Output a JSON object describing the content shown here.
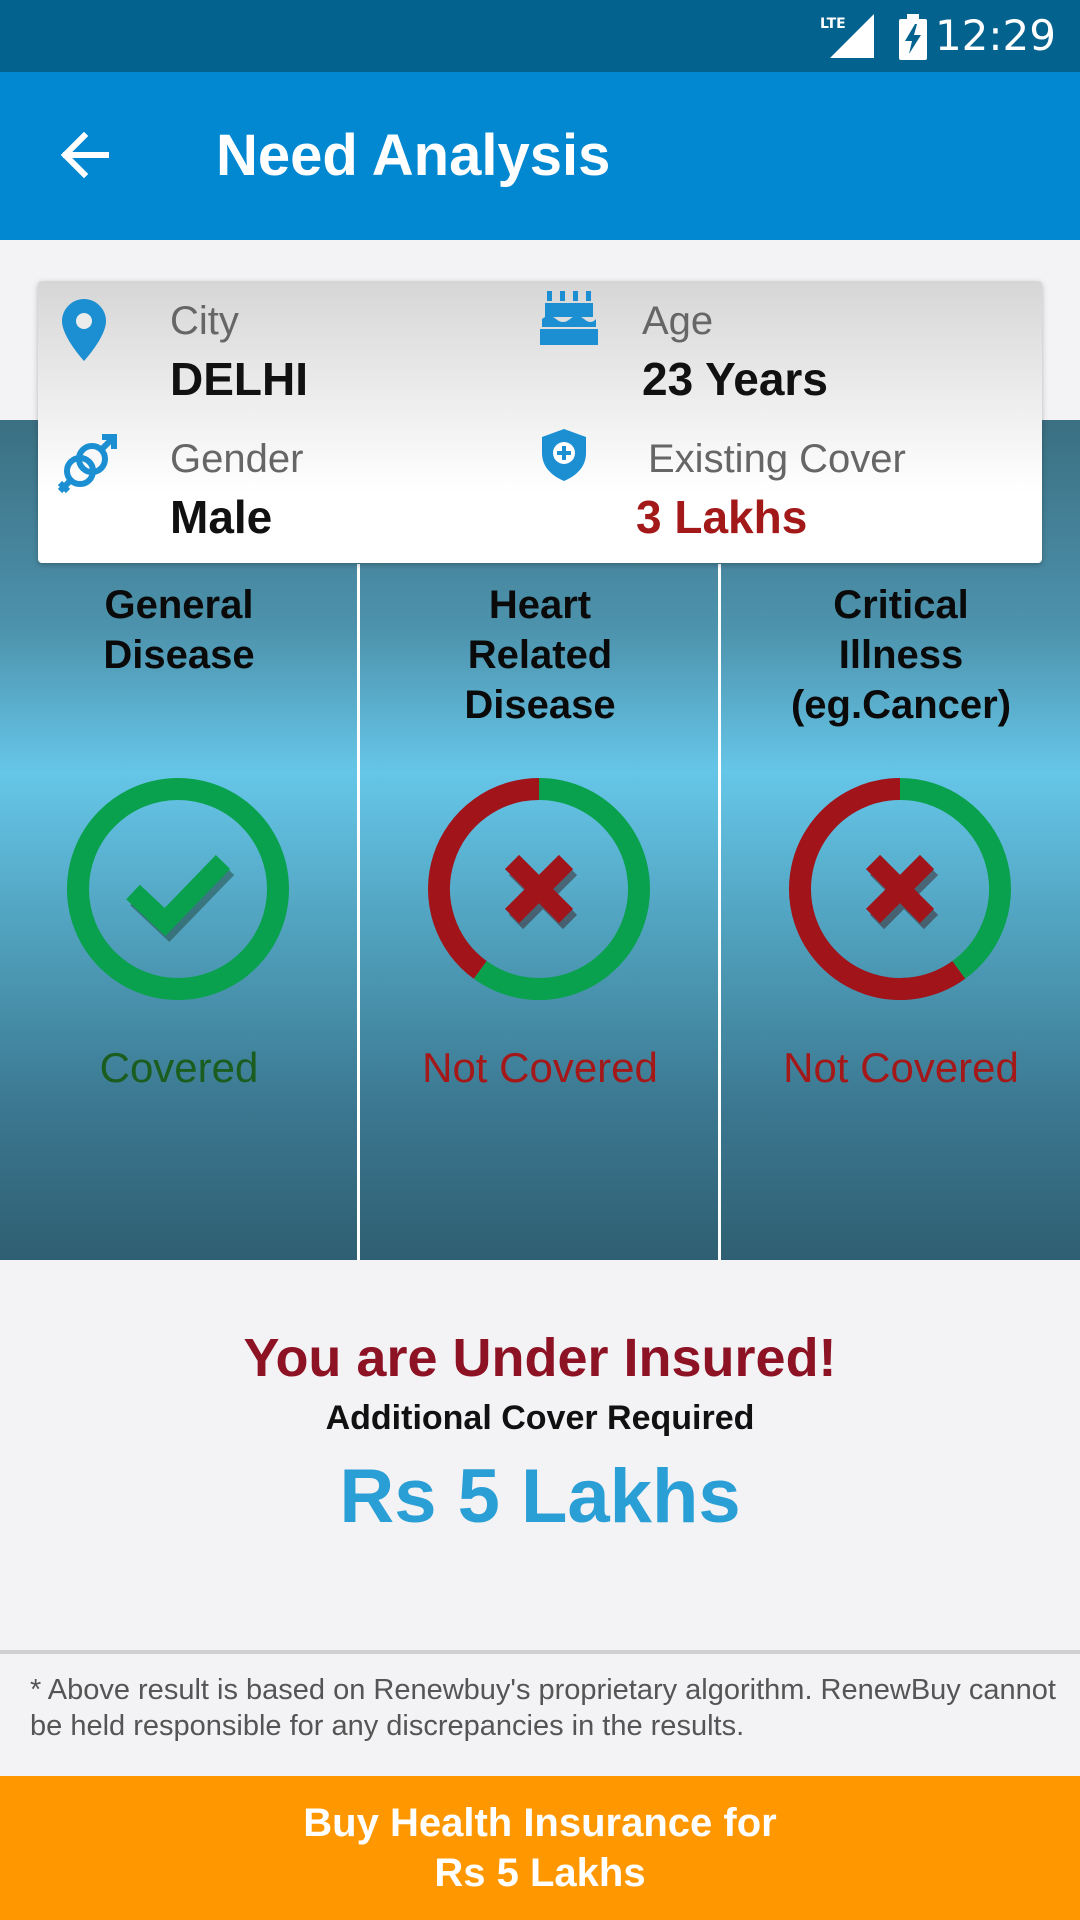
{
  "status_bar": {
    "time": "12:29",
    "network": "LTE"
  },
  "app_bar": {
    "title": "Need Analysis",
    "back_icon": "arrow-left-icon"
  },
  "profile": {
    "city": {
      "label": "City",
      "value": "DELHI",
      "icon": "location-pin-icon"
    },
    "age": {
      "label": "Age",
      "value": "23 Years",
      "icon": "birthday-cake-icon"
    },
    "gender": {
      "label": "Gender",
      "value": "Male",
      "icon": "gender-symbol-icon"
    },
    "existing_cover": {
      "label": "Existing Cover",
      "value": "3 Lakhs",
      "icon": "shield-plus-icon"
    }
  },
  "coverage": [
    {
      "title": "General\nDisease",
      "status": "Covered",
      "covered": true,
      "covered_fraction": 1.0,
      "icon": "checkmark-icon"
    },
    {
      "title": "Heart\nRelated\nDisease",
      "status": "Not Covered",
      "covered": false,
      "covered_fraction": 0.6,
      "icon": "cross-icon"
    },
    {
      "title": "Critical\nIllness\n(eg.Cancer)",
      "status": "Not Covered",
      "covered": false,
      "covered_fraction": 0.4,
      "icon": "cross-icon"
    }
  ],
  "colors": {
    "covered": "#0aa14e",
    "not_covered": "#a0141a",
    "accent": "#0288d1",
    "button": "#ff9800"
  },
  "result": {
    "headline": "You are Under Insured!",
    "subheading": "Additional Cover Required",
    "amount": "Rs 5 Lakhs"
  },
  "disclaimer": "* Above result is based on Renewbuy's proprietary algorithm. RenewBuy cannot be held responsible for any discrepancies in the results.",
  "buy_button": {
    "line1": "Buy Health Insurance for",
    "line2": "Rs 5 Lakhs"
  }
}
